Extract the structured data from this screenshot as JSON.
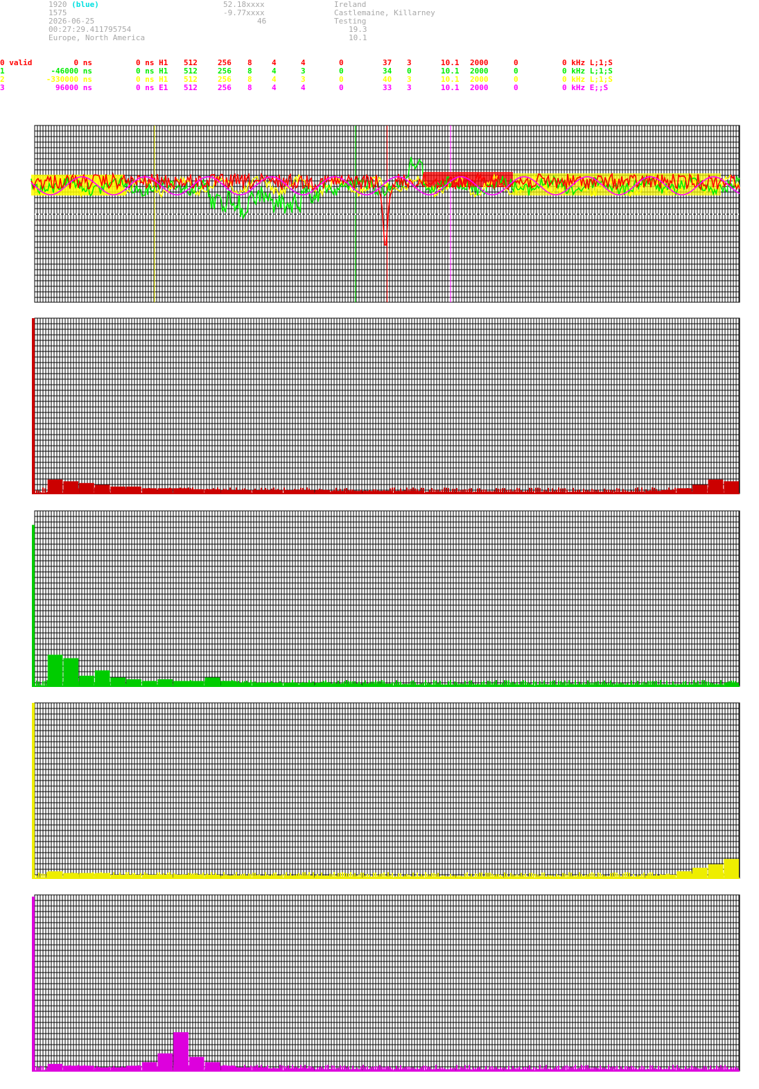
{
  "header": {
    "col1": [
      "1920",
      "1575",
      "2026-06-25",
      "00:27:29.411795754",
      "Europe, North America"
    ],
    "col1_blue": "(blue)",
    "col2": [
      "52.18xxxx",
      "-9.77xxxx",
      "46"
    ],
    "col3": [
      "Ireland",
      "Castlemaine, Killarney",
      "Testing",
      "19.3",
      "10.1"
    ]
  },
  "colors": {
    "ch0": "#ff0000",
    "ch1": "#00ee00",
    "ch2": "#ffff00",
    "ch3": "#ff00ff",
    "grid": "#000000",
    "hist0": "#cc0000",
    "hist1": "#00cc00",
    "hist2": "#eeee00",
    "hist3": "#dd00dd"
  },
  "channels": [
    {
      "cells": [
        "0 valid",
        "0 ns",
        "0 ns H1",
        "512",
        "256",
        "8",
        "4",
        "4",
        "0",
        "37",
        "3",
        "10.1",
        "2000",
        "0",
        "0 kHz L;1;S"
      ]
    },
    {
      "cells": [
        "1",
        "-46000 ns",
        "0 ns H1",
        "512",
        "256",
        "8",
        "4",
        "3",
        "0",
        "34",
        "0",
        "10.1",
        "2000",
        "0",
        "0 kHz L;1;S"
      ]
    },
    {
      "cells": [
        "2",
        "-330000 ns",
        "0 ns H1",
        "512",
        "256",
        "8",
        "4",
        "3",
        "0",
        "40",
        "3",
        "10.1",
        "2000",
        "0",
        "0 kHz L;1;S"
      ]
    },
    {
      "cells": [
        "3",
        "96000 ns",
        "0 ns E1",
        "512",
        "256",
        "8",
        "4",
        "4",
        "0",
        "33",
        "3",
        "10.1",
        "2000",
        "0",
        "0 kHz E;;S"
      ]
    }
  ],
  "chart_data": [
    {
      "type": "line",
      "markers": [
        {
          "channel": 2,
          "x": 0.17
        },
        {
          "channel": 1,
          "x": 0.455
        },
        {
          "channel": 0,
          "x": 0.5
        },
        {
          "channel": 3,
          "x": 0.59
        }
      ]
    },
    {
      "type": "bar",
      "channel": 0,
      "values": [
        1.0,
        0.08,
        0.07,
        0.06,
        0.05,
        0.04,
        0.04,
        0.03,
        0.03,
        0.03,
        0.025,
        0.025,
        0.02,
        0.02,
        0.02,
        0.02,
        0.02,
        0.02,
        0.02,
        0.015,
        0.015,
        0.015,
        0.015,
        0.015,
        0.015,
        0.01,
        0.01,
        0.01,
        0.01,
        0.01,
        0.01,
        0.01,
        0.01,
        0.01,
        0.01,
        0.01,
        0.01,
        0.01,
        0.01,
        0.015,
        0.02,
        0.03,
        0.05,
        0.08,
        0.07
      ]
    },
    {
      "type": "bar",
      "channel": 1,
      "values": [
        0.92,
        0.18,
        0.16,
        0.06,
        0.09,
        0.05,
        0.04,
        0.03,
        0.04,
        0.03,
        0.03,
        0.05,
        0.03,
        0.02,
        0.02,
        0.02,
        0.02,
        0.02,
        0.02,
        0.015,
        0.015,
        0.015,
        0.015,
        0.01,
        0.01,
        0.01,
        0.01,
        0.01,
        0.01,
        0.01,
        0.01,
        0.01,
        0.01,
        0.01,
        0.01,
        0.01,
        0.01,
        0.01,
        0.01,
        0.01,
        0.01,
        0.01,
        0.01,
        0.01,
        0.02
      ]
    },
    {
      "type": "bar",
      "channel": 2,
      "values": [
        1.0,
        0.04,
        0.03,
        0.03,
        0.03,
        0.02,
        0.02,
        0.02,
        0.02,
        0.02,
        0.02,
        0.02,
        0.015,
        0.015,
        0.015,
        0.015,
        0.015,
        0.015,
        0.015,
        0.01,
        0.01,
        0.01,
        0.01,
        0.01,
        0.01,
        0.01,
        0.01,
        0.01,
        0.01,
        0.01,
        0.01,
        0.01,
        0.01,
        0.01,
        0.01,
        0.01,
        0.01,
        0.01,
        0.01,
        0.015,
        0.02,
        0.04,
        0.06,
        0.08,
        0.11
      ]
    },
    {
      "type": "bar",
      "channel": 3,
      "values": [
        0.99,
        0.04,
        0.03,
        0.03,
        0.02,
        0.02,
        0.03,
        0.05,
        0.1,
        0.22,
        0.08,
        0.05,
        0.03,
        0.02,
        0.02,
        0.015,
        0.015,
        0.015,
        0.01,
        0.01,
        0.01,
        0.01,
        0.01,
        0.01,
        0.01,
        0.01,
        0.01,
        0.01,
        0.01,
        0.01,
        0.01,
        0.01,
        0.01,
        0.01,
        0.01,
        0.01,
        0.01,
        0.01,
        0.01,
        0.01,
        0.01,
        0.01,
        0.01,
        0.01,
        0.01
      ]
    }
  ]
}
